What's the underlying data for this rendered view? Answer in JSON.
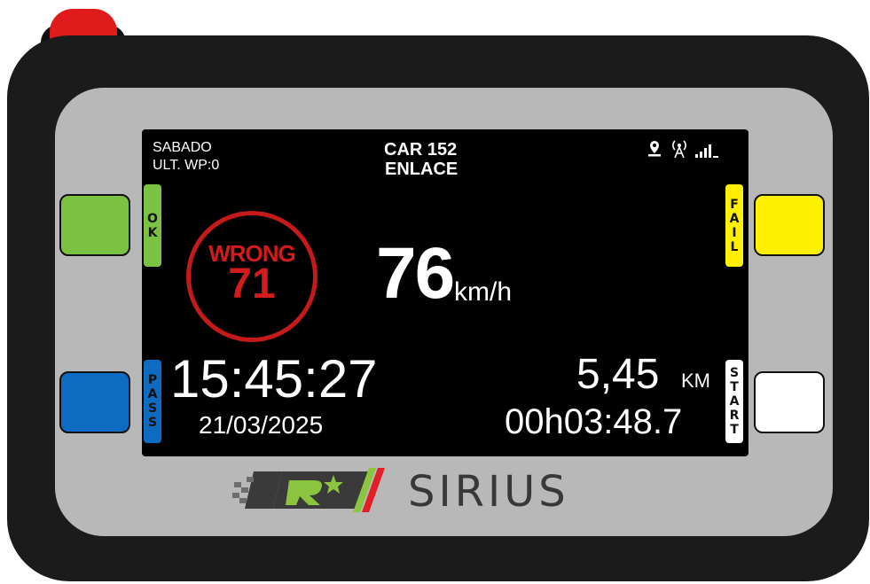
{
  "device": {
    "brand": "SIRIUS",
    "colors": {
      "power": "#e01b1b",
      "ok": "#7cc242",
      "pass": "#0d6cc2",
      "fail": "#ffef00",
      "start": "#ffffff",
      "alert": "#d21b1b"
    }
  },
  "buttons": {
    "ok": "OK",
    "pass": "PASS",
    "fail": "FAIL",
    "start": "START"
  },
  "header": {
    "day": "SABADO",
    "last_wp": "ULT. WP:0",
    "car": "CAR 152",
    "link": "ENLACE",
    "icons": [
      "location-pin-icon",
      "antenna-icon",
      "signal-bars-icon"
    ]
  },
  "alert": {
    "label": "WRONG",
    "value": "71"
  },
  "speed": {
    "value": "76",
    "unit": "km/h"
  },
  "clock": {
    "time": "15:45:27",
    "date": "21/03/2025"
  },
  "distance": {
    "value": "5,45",
    "unit": "KM",
    "elapsed": "00h03:48.7"
  }
}
